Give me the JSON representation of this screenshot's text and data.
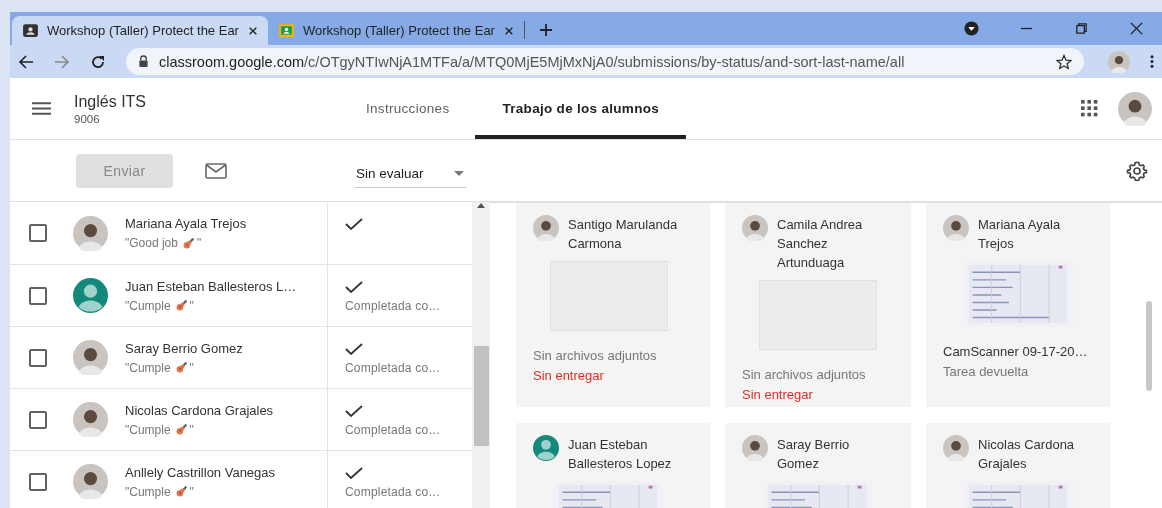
{
  "browser": {
    "tabs": [
      {
        "title": "Workshop (Taller) Protect the Ear",
        "selected": true,
        "favicon": {
          "kind": "dark"
        }
      },
      {
        "title": "Workshop (Taller) Protect the Ear",
        "selected": false,
        "favicon": {
          "kind": "classroom"
        }
      }
    ],
    "url": {
      "host": "classroom.google.com",
      "path": "/c/OTgyNTIwNjA1MTFa/a/MTQ0MjE5MjMxNjA0/submissions/by-status/and-sort-last-name/all"
    }
  },
  "course": {
    "name": "Inglés ITS",
    "section": "9006"
  },
  "nav_tabs": [
    {
      "label": "Instrucciones",
      "selected": false
    },
    {
      "label": "Trabajo de los alumnos",
      "selected": true
    }
  ],
  "toolbar": {
    "send_button": {
      "label": "Enviar",
      "disabled": true
    },
    "filter": "Sin evaluar"
  },
  "students": [
    {
      "name": "Mariana Ayala Trejos",
      "comment_before": "\"Good job",
      "comment_after": "\"",
      "checked": false
    },
    {
      "name": "Juan Esteban Ballesteros L…",
      "comment_before": "\"Cumple",
      "comment_after": "\"",
      "status": "Completada co…",
      "checked": false,
      "avatar": {
        "kind": "default"
      }
    },
    {
      "name": "Saray Berrio Gomez",
      "comment_before": "\"Cumple",
      "comment_after": "\"",
      "status": "Completada co…",
      "checked": false
    },
    {
      "name": "Nicolas Cardona Grajales",
      "comment_before": "\"Cumple",
      "comment_after": "\"",
      "status": "Completada co…",
      "checked": false
    },
    {
      "name": "Anllely Castrillon Vanegas",
      "comment_before": "\"Cumple",
      "comment_after": "\"",
      "status": "Completada co…",
      "checked": false
    }
  ],
  "cards": [
    {
      "name": "Santigo Marulanda Carmona",
      "attachment": {
        "kind": "none",
        "label": "Sin archivos adjuntos"
      },
      "status": {
        "text": "Sin entregar",
        "kind": "missing"
      }
    },
    {
      "name": "Camila Andrea Sanchez Artunduaga",
      "attachment": {
        "kind": "none",
        "label": "Sin archivos adjuntos"
      },
      "status": {
        "text": "Sin entregar",
        "kind": "missing"
      }
    },
    {
      "name": "Mariana Ayala Trejos",
      "attachment": {
        "kind": "picture",
        "label": "CamScanner 09-17-20…"
      },
      "status": {
        "text": "Tarea devuelta",
        "kind": "returned"
      }
    },
    {
      "name": "Juan Esteban Ballesteros Lopez",
      "avatar": {
        "kind": "default"
      }
    },
    {
      "name": "Saray Berrio Gomez"
    },
    {
      "name": "Nicolas Cardona Grajales"
    }
  ]
}
